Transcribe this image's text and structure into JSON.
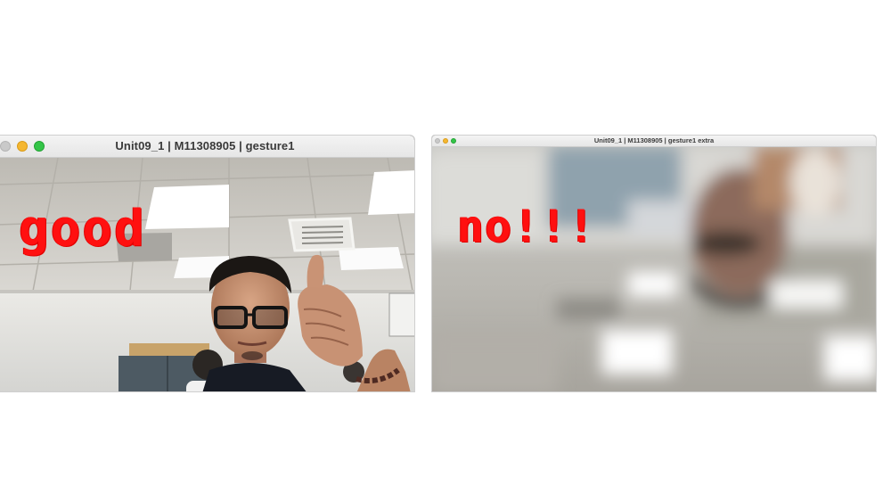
{
  "windows": [
    {
      "title": "Unit09_1 | M11308905 | gesture1",
      "overlay_text": "good"
    },
    {
      "title": "Unit09_1 | M11308905 | gesture1 extra",
      "overlay_text": "no!!!"
    }
  ],
  "colors": {
    "overlay_text": "#ff1010",
    "traffic_close": "#c9c9c9",
    "traffic_minimize": "#f5b731",
    "traffic_zoom": "#34c548"
  }
}
